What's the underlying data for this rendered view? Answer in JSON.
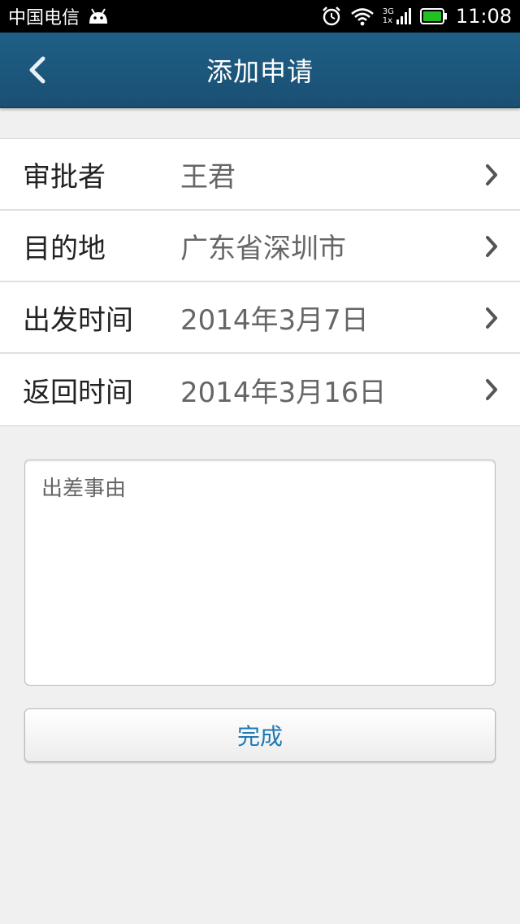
{
  "status_bar": {
    "carrier": "中国电信",
    "network_label": "3G",
    "network_sub": "1x",
    "time": "11:08",
    "icons": [
      "android-icon",
      "alarm-icon",
      "wifi-icon",
      "signal-icon",
      "battery-icon"
    ]
  },
  "nav": {
    "title": "添加申请",
    "back_icon": "chevron-left-icon"
  },
  "form": {
    "rows": [
      {
        "label": "审批者",
        "value": "王君"
      },
      {
        "label": "目的地",
        "value": "广东省深圳市"
      },
      {
        "label": "出发时间",
        "value": "2014年3月7日"
      },
      {
        "label": "返回时间",
        "value": "2014年3月16日"
      }
    ]
  },
  "reason": {
    "placeholder": "出差事由",
    "value": ""
  },
  "done_button": {
    "label": "完成"
  },
  "colors": {
    "nav_bar": "#1f5f86",
    "accent": "#1f78b4",
    "battery": "#22c022"
  }
}
